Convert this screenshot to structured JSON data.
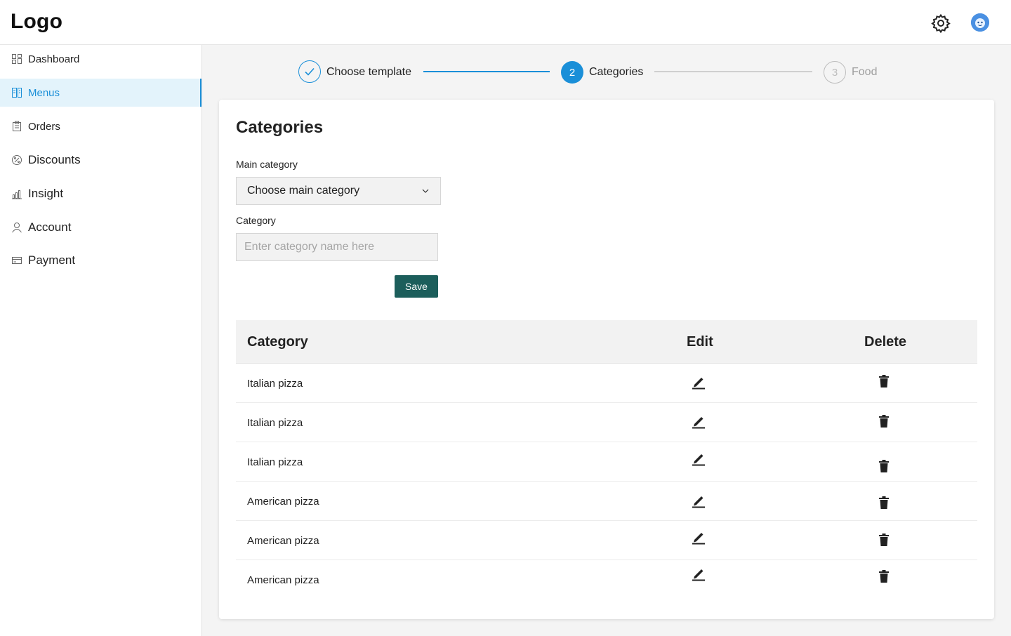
{
  "header": {
    "logo": "Logo",
    "settings_icon": "gear-icon",
    "avatar_icon": "user-avatar"
  },
  "sidebar": {
    "items": [
      {
        "label": "Dashboard",
        "icon": "dashboard-icon",
        "active": false
      },
      {
        "label": "Menus",
        "icon": "menus-icon",
        "active": true
      },
      {
        "label": "Orders",
        "icon": "orders-icon",
        "active": false
      },
      {
        "label": "Discounts",
        "icon": "discounts-icon",
        "active": false
      },
      {
        "label": "Insight",
        "icon": "insight-icon",
        "active": false
      },
      {
        "label": "Account",
        "icon": "account-icon",
        "active": false
      },
      {
        "label": "Payment",
        "icon": "payment-icon",
        "active": false
      }
    ]
  },
  "stepper": {
    "steps": [
      {
        "label": "Choose template",
        "status": "done"
      },
      {
        "number": "2",
        "label": "Categories",
        "status": "active"
      },
      {
        "number": "3",
        "label": "Food",
        "status": "pending"
      }
    ]
  },
  "form": {
    "title": "Categories",
    "main_category_label": "Main category",
    "main_category_value": "Choose main category",
    "category_label": "Category",
    "category_placeholder": "Enter category name here",
    "category_value": "",
    "save_label": "Save"
  },
  "table": {
    "headers": {
      "category": "Category",
      "edit": "Edit",
      "delete": "Delete"
    },
    "rows": [
      {
        "category": "Italian pizza"
      },
      {
        "category": "Italian pizza"
      },
      {
        "category": "Italian pizza"
      },
      {
        "category": "American pizza"
      },
      {
        "category": "American pizza"
      },
      {
        "category": "American pizza"
      }
    ]
  },
  "colors": {
    "accent": "#1a8fd8",
    "active_bg": "#e3f3fb",
    "save_button": "#1c5e5b",
    "pending": "#bdbdbd"
  }
}
